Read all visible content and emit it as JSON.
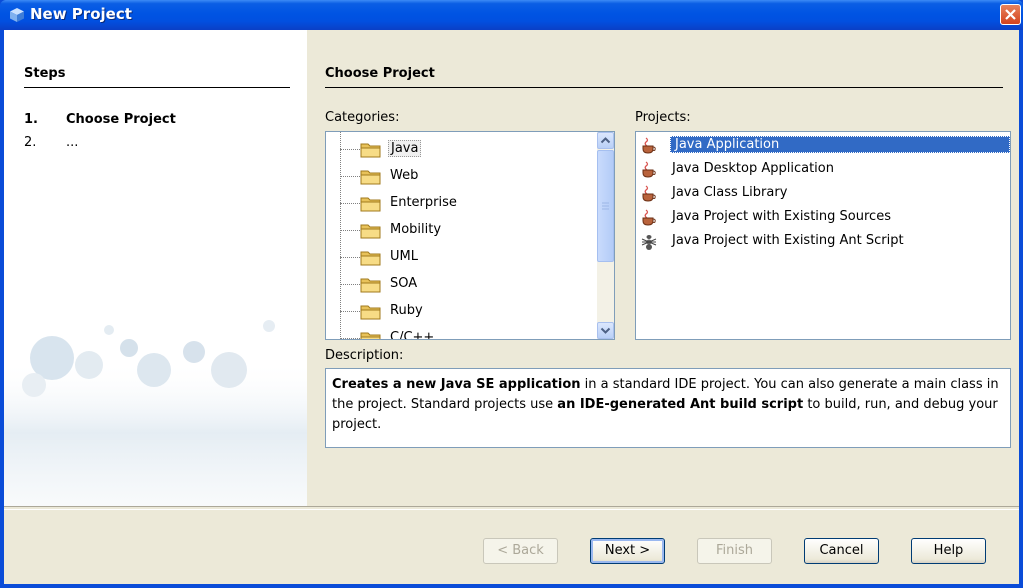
{
  "window": {
    "title": "New Project"
  },
  "steps": {
    "title": "Steps",
    "items": [
      {
        "num": "1.",
        "label": "Choose Project"
      },
      {
        "num": "2.",
        "label": "..."
      }
    ]
  },
  "panel": {
    "title": "Choose Project",
    "categories_label": "Categories:",
    "projects_label": "Projects:",
    "description_label": "Description:"
  },
  "categories": [
    "Java",
    "Web",
    "Enterprise",
    "Mobility",
    "UML",
    "SOA",
    "Ruby",
    "C/C++"
  ],
  "selected_category": "Java",
  "projects": [
    {
      "label": "Java Application",
      "icon": "java-cup-icon"
    },
    {
      "label": "Java Desktop Application",
      "icon": "java-cup-icon"
    },
    {
      "label": "Java Class Library",
      "icon": "java-cup-icon"
    },
    {
      "label": "Java Project with Existing Sources",
      "icon": "java-cup-icon"
    },
    {
      "label": "Java Project with Existing Ant Script",
      "icon": "ant-icon"
    }
  ],
  "selected_project": "Java Application",
  "description": {
    "bold1": "Creates a new Java SE application",
    "text1": " in a standard IDE project. You can also generate a main class in the project. Standard projects use ",
    "bold2": "an IDE-generated Ant build script",
    "text2": " to build, run, and debug your project."
  },
  "buttons": {
    "back": "< Back",
    "next": "Next >",
    "finish": "Finish",
    "cancel": "Cancel",
    "help": "Help"
  },
  "colors": {
    "titlebar": "#0054e3",
    "selection": "#316ac5",
    "dialog_bg": "#ece9d8"
  }
}
